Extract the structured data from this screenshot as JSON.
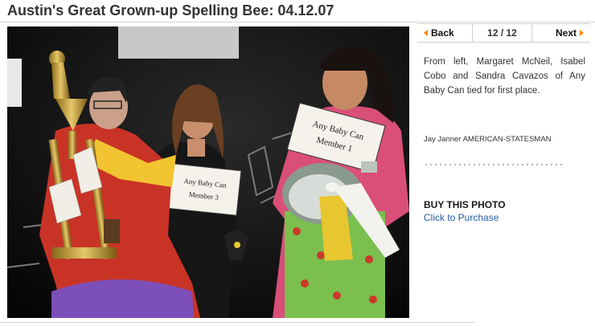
{
  "header": {
    "title": "Austin's Great Grown-up Spelling Bee: 04.12.07"
  },
  "gallery_nav": {
    "back_label": "Back",
    "counter": "12 / 12",
    "next_label": "Next",
    "arrow_color": "#f08a00"
  },
  "photo": {
    "sign_left_line1": "Any Baby Can",
    "sign_left_line2": "Member 3",
    "sign_right_line1": "Any Baby Can",
    "sign_right_line2": "Member 1"
  },
  "caption": {
    "text": "From left, Margaret McNeil, Isabel Cobo and Sandra Cavazos of Any Baby Can tied for first place.",
    "credit": "Jay Janner AMERICAN-STATESMAN"
  },
  "purchase": {
    "heading": "BUY THIS PHOTO",
    "link_label": "Click to Purchase",
    "link_color": "#1f5fa8"
  }
}
